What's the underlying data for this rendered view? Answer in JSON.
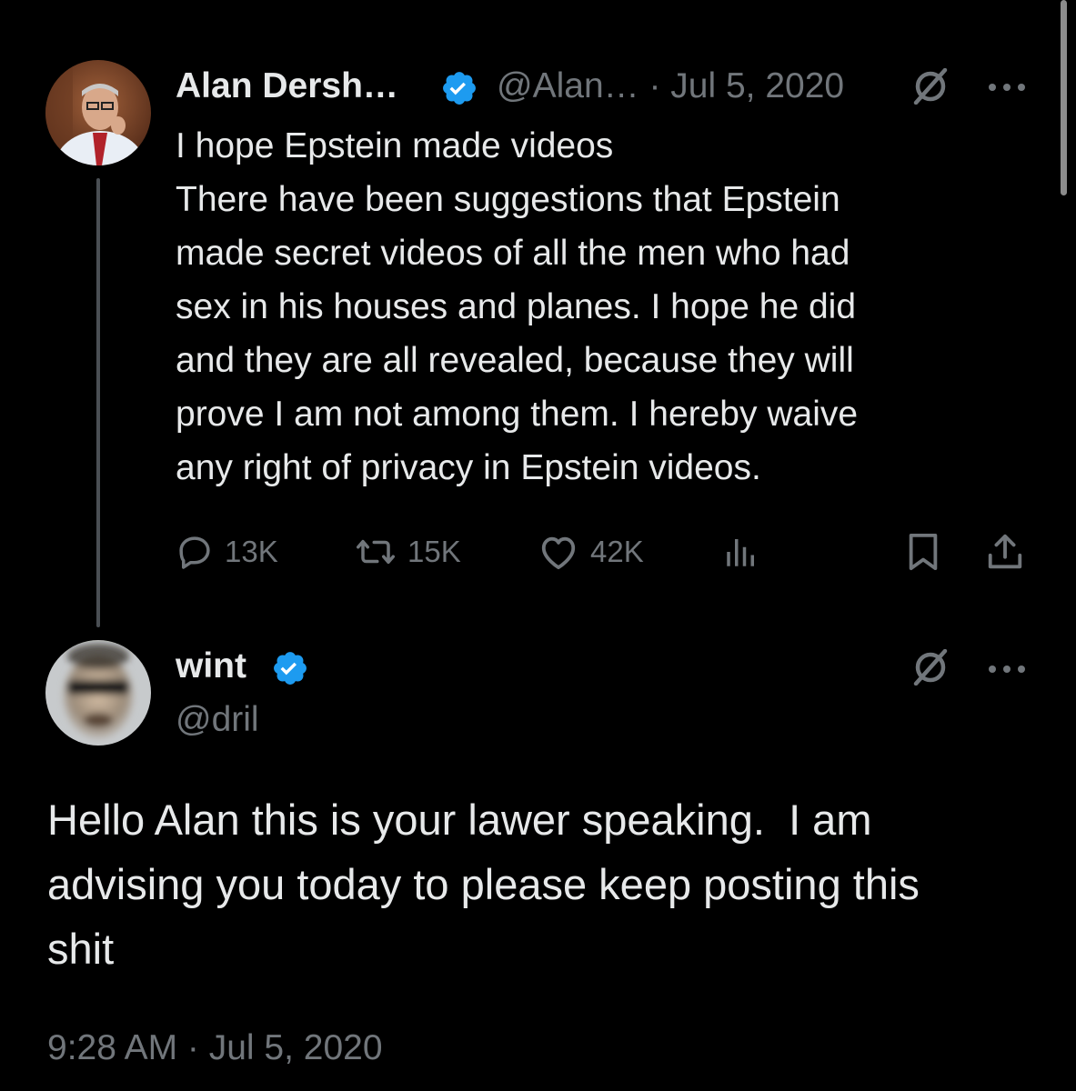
{
  "parent_tweet": {
    "author_name": "Alan Dersh…",
    "verified": true,
    "handle_and_date": "@Alan… · Jul 5, 2020",
    "lines": [
      "I hope Epstein made videos",
      "There have been suggestions that Epstein",
      "made secret videos of all the men who had",
      "sex in his houses and planes. I hope he did",
      "and they are all revealed, because they will",
      "prove I am not among them. I hereby waive",
      "any right of privacy in Epstein videos."
    ],
    "replies": "13K",
    "reposts": "15K",
    "likes": "42K"
  },
  "main_tweet": {
    "author_name": "wint",
    "verified": true,
    "handle": "@dril",
    "lines": [
      "Hello Alan this is your lawer speaking.  I am",
      "advising you today to please keep posting this",
      "shit"
    ],
    "timestamp": "9:28 AM · Jul 5, 2020"
  },
  "icons": {
    "verified": "verified-badge-icon",
    "grok": "grok-icon",
    "more": "more-options-icon",
    "reply": "reply-icon",
    "repost": "repost-icon",
    "like": "like-icon",
    "views": "views-icon",
    "bookmark": "bookmark-icon",
    "share": "share-icon"
  },
  "colors": {
    "background": "#000000",
    "text": "#e7e9ea",
    "secondary": "#71767b",
    "verified_blue": "#1d9bf0"
  }
}
